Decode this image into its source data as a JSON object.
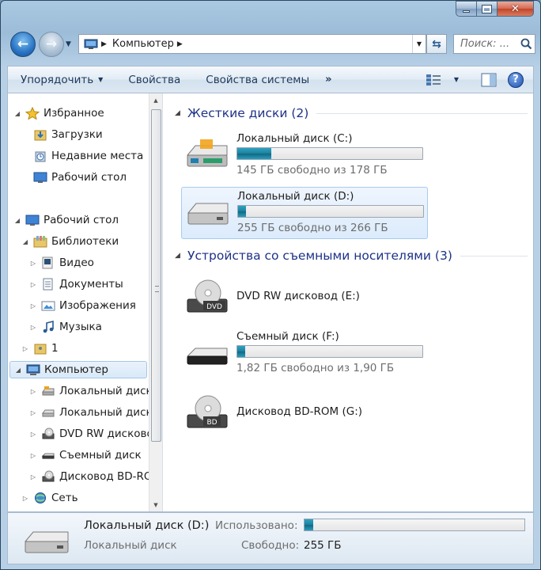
{
  "window": {
    "caption_close": "✕"
  },
  "nav": {
    "back_glyph": "←",
    "forward_glyph": "→",
    "breadcrumb": "Компьютер",
    "search_placeholder": "Поиск: ..."
  },
  "toolbar": {
    "organize": "Упорядочить",
    "properties": "Свойства",
    "system_properties": "Свойства системы",
    "more": "»",
    "help": "?"
  },
  "tree": {
    "favorites": "Избранное",
    "downloads": "Загрузки",
    "recent": "Недавние места",
    "desktop_fav": "Рабочий стол",
    "desktop": "Рабочий стол",
    "libraries": "Библиотеки",
    "video": "Видео",
    "documents": "Документы",
    "images": "Изображения",
    "music": "Музыка",
    "folder1": "1",
    "computer": "Компьютер",
    "drive_c": "Локальный диск",
    "drive_d": "Локальный диск",
    "drive_e": "DVD RW дисковод",
    "drive_f": "Съемный диск",
    "drive_g": "Дисковод BD-ROM",
    "network": "Сеть"
  },
  "groups": {
    "hard_disks": "Жесткие диски (2)",
    "removable": "Устройства со съемными носителями (3)"
  },
  "drives": {
    "c": {
      "name": "Локальный диск (C:)",
      "free": "145 ГБ свободно из 178 ГБ",
      "used_fraction": 0.185
    },
    "d": {
      "name": "Локальный диск (D:)",
      "free": "255 ГБ свободно из 266 ГБ",
      "used_fraction": 0.041
    },
    "e": {
      "name": "DVD RW дисковод (E:)"
    },
    "f": {
      "name": "Съемный диск (F:)",
      "free": "1,82 ГБ свободно из 1,90 ГБ",
      "used_fraction": 0.042
    },
    "g": {
      "name": "Дисковод BD-ROM (G:)"
    }
  },
  "details": {
    "title": "Локальный диск (D:)",
    "subtitle": "Локальный диск",
    "used_label": "Использовано:",
    "free_label": "Свободно:",
    "free_value": "255 ГБ",
    "used_fraction": 0.041
  },
  "colors": {
    "accent_title": "#1e3287",
    "bar_fill": "#1d7f9b"
  }
}
